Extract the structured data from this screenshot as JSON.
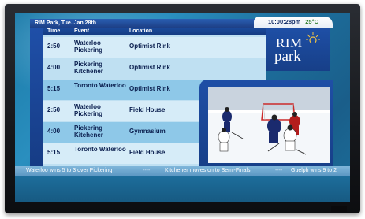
{
  "header": {
    "location_date": "RIM Park,  Tue. Jan 28th",
    "time": "10:00:28pm",
    "temperature": "25°C"
  },
  "table": {
    "columns": [
      "Time",
      "Event",
      "Location"
    ],
    "rows": [
      {
        "time": "2:50",
        "event": "Waterloo Pickering",
        "location": "Optimist Rink"
      },
      {
        "time": "4:00",
        "event": "Pickering Kitchener",
        "location": "Optimist Rink"
      },
      {
        "time": "5:15",
        "event": "Toronto Waterloo",
        "location": "Optimist Rink"
      },
      {
        "time": "2:50",
        "event": "Waterloo Pickering",
        "location": "Field House"
      },
      {
        "time": "4:00",
        "event": "Pickering Kitchener",
        "location": "Gymnasium"
      },
      {
        "time": "5:15",
        "event": "Toronto Waterloo",
        "location": "Field House"
      }
    ]
  },
  "logo": {
    "line1": "RIM",
    "line2": "park"
  },
  "ticker": {
    "items": [
      "Waterloo wins 5 to 3 over Pickering",
      "Kitchener moves on to Semi-Finals",
      "Guelph wins 9 to 2"
    ],
    "separator": "----"
  },
  "colors": {
    "screen_blue": "#1b7aa8",
    "header_blue": "#1d3f86",
    "row_light": "#bfe0f2",
    "row_band": "#8ec8e8",
    "text_dark_blue": "#0b1f4f"
  }
}
